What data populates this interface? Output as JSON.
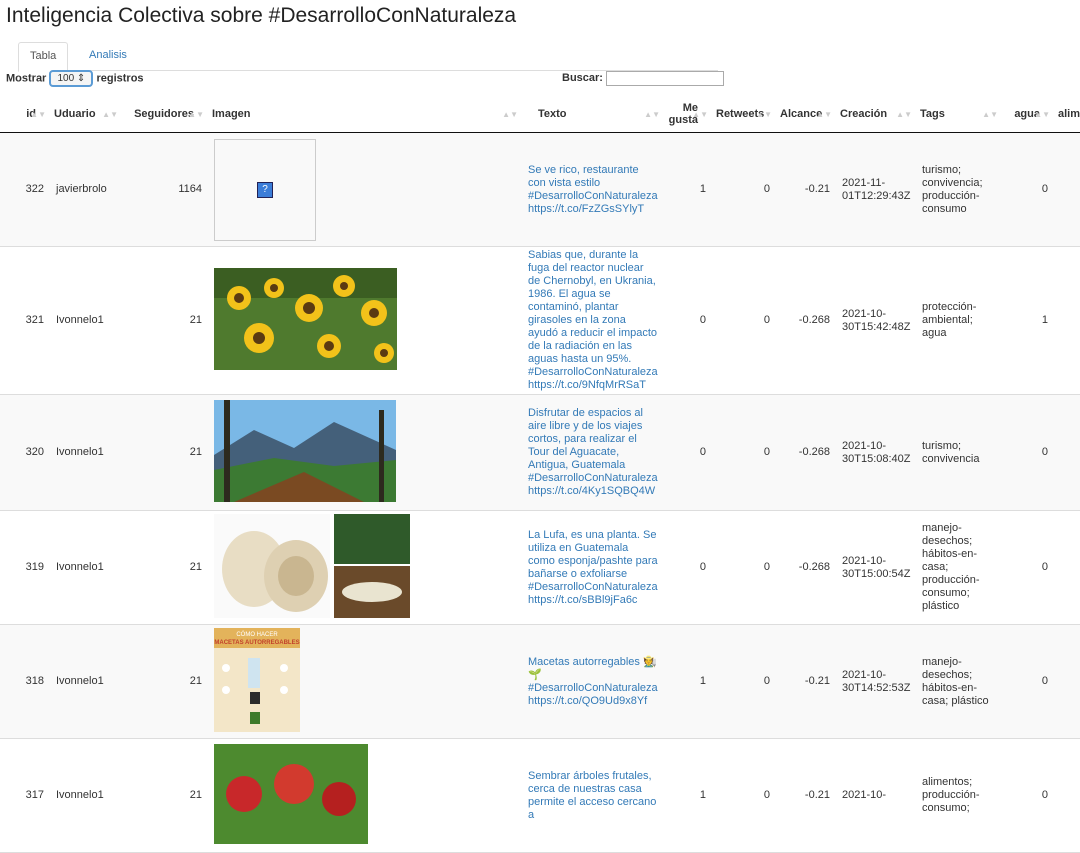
{
  "title": "Inteligencia Colectiva sobre #DesarrolloConNaturaleza",
  "tabs": [
    "Tabla",
    "Analisis"
  ],
  "controls": {
    "show_label": "Mostrar",
    "page_size": "100",
    "records_label": "registros",
    "search_label": "Buscar:",
    "search_value": ""
  },
  "columns": [
    "id",
    "Uduario",
    "Seguidores",
    "Imagen",
    "Texto",
    "Me gusta",
    "Retweets",
    "Alcance",
    "Creación",
    "Tags",
    "agua",
    "alim"
  ],
  "rows": [
    {
      "id": "322",
      "user": "javierbrolo",
      "followers": "1164",
      "image": "broken",
      "text": "Se ve rico, restaurante con vista estilo #DesarrolloConNaturaleza https://t.co/FzZGsSYlyT",
      "likes": "1",
      "retweets": "0",
      "reach": "-0.21",
      "created": "2021-11-01T12:29:43Z",
      "tags": "turismo; convivencia; producción-consumo",
      "agua": "0"
    },
    {
      "id": "321",
      "user": "Ivonnelo1",
      "followers": "21",
      "image": "sunflowers",
      "text": "Sabias que, durante la fuga del reactor nuclear de Chernobyl, en Ukrania, 1986. El agua se contaminó, plantar girasoles en la zona ayudó a reducir el impacto de la radiación en las aguas hasta un 95%. #DesarrolloConNaturaleza https://t.co/9NfqMrRSaT",
      "likes": "0",
      "retweets": "0",
      "reach": "-0.268",
      "created": "2021-10-30T15:42:48Z",
      "tags": "protección-ambiental; agua",
      "agua": "1"
    },
    {
      "id": "320",
      "user": "Ivonnelo1",
      "followers": "21",
      "image": "landscape",
      "text": "Disfrutar de espacios al aire libre y de los viajes cortos, para realizar el Tour del Aguacate, Antigua, Guatemala #DesarrolloConNaturaleza https://t.co/4Ky1SQBQ4W",
      "likes": "0",
      "retweets": "0",
      "reach": "-0.268",
      "created": "2021-10-30T15:08:40Z",
      "tags": "turismo; convivencia",
      "agua": "0"
    },
    {
      "id": "319",
      "user": "Ivonnelo1",
      "followers": "21",
      "image": "loofah",
      "text": "La Lufa, es una planta. Se utiliza en Guatemala como esponja/pashte para bañarse o exfoliarse #DesarrolloConNaturaleza https://t.co/sBBl9jFa6c",
      "likes": "0",
      "retweets": "0",
      "reach": "-0.268",
      "created": "2021-10-30T15:00:54Z",
      "tags": "manejo-desechos; hábitos-en-casa; producción-consumo; plástico",
      "agua": "0"
    },
    {
      "id": "318",
      "user": "Ivonnelo1",
      "followers": "21",
      "image": "infographic",
      "image_text": "CÓMO HACER MACETAS AUTORREGABLES",
      "text": "Macetas autorregables 🧑‍🌾🌱 #DesarrolloConNaturaleza https://t.co/QO9Ud9x8Yf",
      "likes": "1",
      "retweets": "0",
      "reach": "-0.21",
      "created": "2021-10-30T14:52:53Z",
      "tags": "manejo-desechos; hábitos-en-casa; plástico",
      "agua": "0"
    },
    {
      "id": "317",
      "user": "Ivonnelo1",
      "followers": "21",
      "image": "apples",
      "text": "Sembrar árboles frutales, cerca de nuestras casa permite el acceso cercano a",
      "likes": "1",
      "retweets": "0",
      "reach": "-0.21",
      "created": "2021-10-",
      "tags": "alimentos; producción-consumo;",
      "agua": "0"
    }
  ]
}
